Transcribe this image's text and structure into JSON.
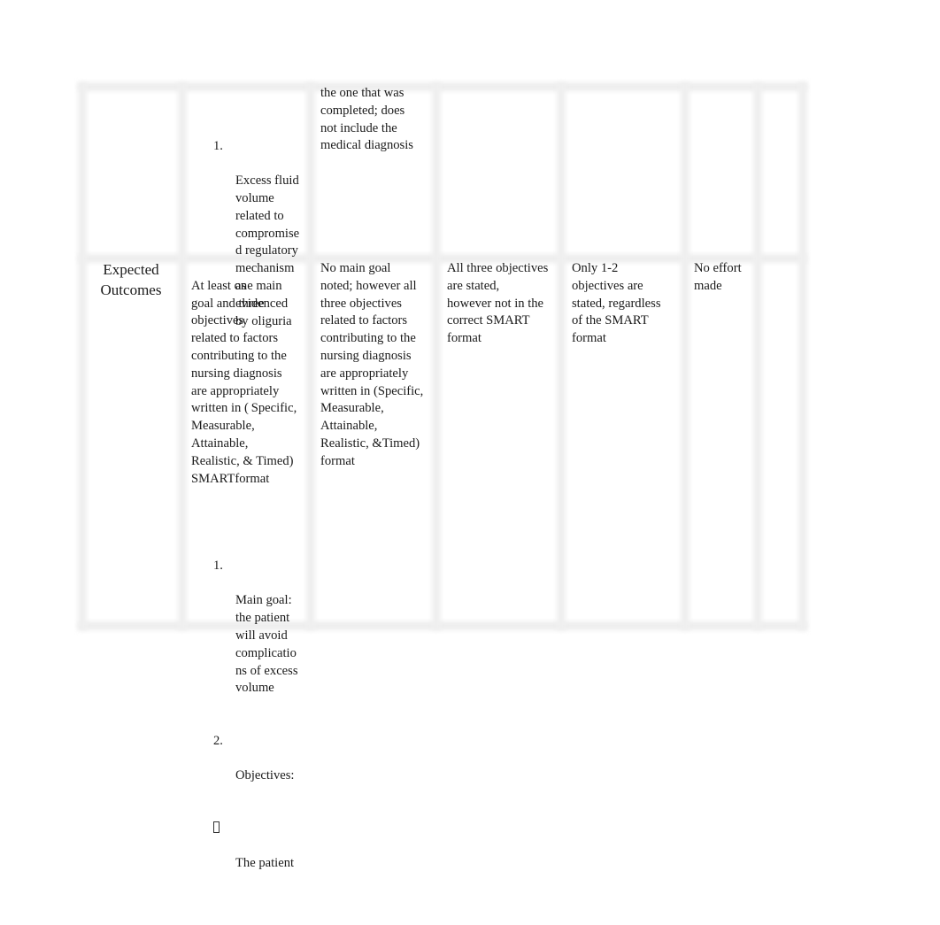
{
  "table": {
    "row_continued": {
      "col_criteria": [
        {
          "number": "1.",
          "text": "Excess fluid\nvolume\nrelated to\ncompromise\nd regulatory\nmechanism\nas\nevidenced\nby oliguria"
        }
      ],
      "col_partial": "the one that was\ncompleted; does\nnot include the\nmedical diagnosis",
      "col_3": "",
      "col_4": "",
      "col_5": "",
      "col_6": ""
    },
    "row_expected_outcomes": {
      "label": "Expected\nOutcomes",
      "col_criteria_intro": "At least one main\ngoal and three\nobjectives\nrelated to factors\ncontributing to the\nnursing diagnosis\nare appropriately\nwritten in ( Specific,\nMeasurable,\nAttainable,\nRealistic, & Timed)\nSMARTformat",
      "col_criteria_list": [
        {
          "number": "1.",
          "text": "Main goal:\nthe patient\nwill avoid\ncomplicatio\nns of excess\nvolume"
        },
        {
          "number": "2.",
          "text": "Objectives:"
        },
        {
          "number": "bullet",
          "text": "The patient"
        }
      ],
      "col_partial": "No main goal\nnoted; however all\nthree   objectives\nrelated to factors\ncontributing to the\nnursing diagnosis\nare appropriately\nwritten in (Specific,\nMeasurable,\nAttainable,\nRealistic, &Timed)\nformat",
      "col_3": "All three objectives\nare stated,\nhowever not in the\ncorrect SMART\nformat",
      "col_4": "Only 1-2\nobjectives are\nstated, regardless\nof the SMART\nformat",
      "col_5": "No effort\nmade",
      "col_6": ""
    }
  }
}
